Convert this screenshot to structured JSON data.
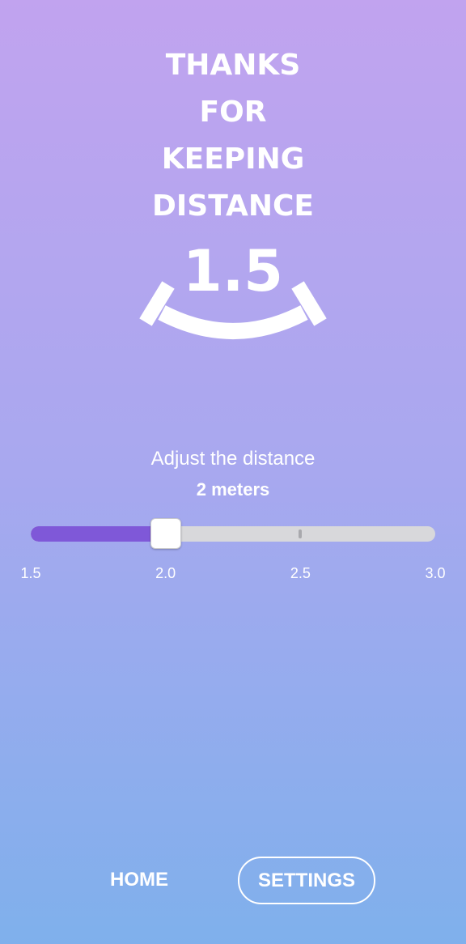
{
  "headline": {
    "lines": [
      "THANKS",
      "FOR",
      "KEEPING",
      "DISTANCE"
    ]
  },
  "indicator": {
    "value": "1.5",
    "icon": "smile-arc-icon"
  },
  "distance": {
    "label": "Adjust the distance",
    "value": "2 meters"
  },
  "slider": {
    "min": 1.5,
    "max": 3.0,
    "current": 2.0,
    "tick_labels": [
      "1.5",
      "2.0",
      "2.5",
      "3.0"
    ],
    "fill_color": "#7f58d8",
    "track_color": "#d8d8db"
  },
  "nav": {
    "home_label": "HOME",
    "settings_label": "SETTINGS"
  },
  "colors": {
    "gradient_top": "#c1a3ef",
    "gradient_bottom": "#7fb0ec",
    "accent": "#7f58d8"
  }
}
